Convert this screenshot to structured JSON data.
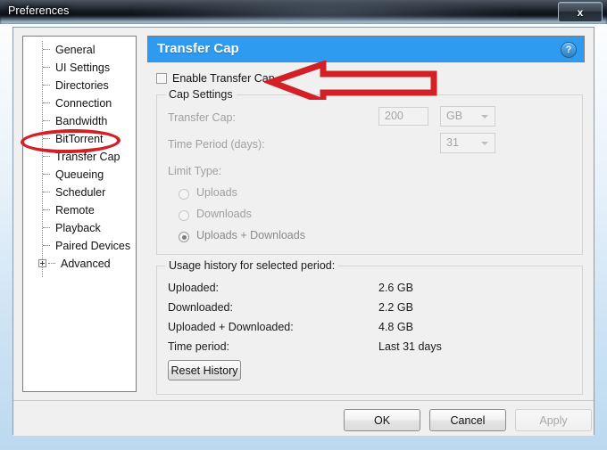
{
  "window": {
    "title": "Preferences",
    "close_label": "x",
    "close_icon": "close-icon"
  },
  "sidebar": {
    "items": [
      {
        "label": "General",
        "expandable": false,
        "selected": false
      },
      {
        "label": "UI Settings",
        "expandable": false,
        "selected": false
      },
      {
        "label": "Directories",
        "expandable": false,
        "selected": false
      },
      {
        "label": "Connection",
        "expandable": false,
        "selected": false
      },
      {
        "label": "Bandwidth",
        "expandable": false,
        "selected": false
      },
      {
        "label": "BitTorrent",
        "expandable": false,
        "selected": false
      },
      {
        "label": "Transfer Cap",
        "expandable": false,
        "selected": true
      },
      {
        "label": "Queueing",
        "expandable": false,
        "selected": false
      },
      {
        "label": "Scheduler",
        "expandable": false,
        "selected": false
      },
      {
        "label": "Remote",
        "expandable": false,
        "selected": false
      },
      {
        "label": "Playback",
        "expandable": false,
        "selected": false
      },
      {
        "label": "Paired Devices",
        "expandable": false,
        "selected": false
      },
      {
        "label": "Advanced",
        "expandable": true,
        "selected": false
      }
    ]
  },
  "page": {
    "header_title": "Transfer Cap",
    "header_bg": "#2e9bf0",
    "help_icon": "help-question-icon",
    "enable_checkbox": {
      "label": "Enable Transfer Cap",
      "checked": false
    }
  },
  "cap_settings": {
    "legend": "Cap Settings",
    "transfer_cap_label": "Transfer Cap:",
    "transfer_cap_value": "200",
    "transfer_cap_unit": "GB",
    "time_period_label": "Time Period (days):",
    "time_period_value": "31",
    "limit_type_label": "Limit Type:",
    "limit_options": [
      {
        "label": "Uploads",
        "selected": false
      },
      {
        "label": "Downloads",
        "selected": false
      },
      {
        "label": "Uploads + Downloads",
        "selected": true
      }
    ],
    "disabled": true
  },
  "usage_history": {
    "legend": "Usage history for selected period:",
    "rows": [
      {
        "label": "Uploaded:",
        "value": "2.6 GB"
      },
      {
        "label": "Downloaded:",
        "value": "2.2 GB"
      },
      {
        "label": "Uploaded + Downloaded:",
        "value": "4.8 GB"
      },
      {
        "label": "Time period:",
        "value": "Last 31 days"
      }
    ],
    "reset_button": "Reset History"
  },
  "footer": {
    "ok": "OK",
    "cancel": "Cancel",
    "apply": "Apply",
    "apply_disabled": true
  },
  "annotations": {
    "color": "#d31f26",
    "arrow": "left-pointing-arrow-annotation",
    "ellipse": "ellipse-highlight-annotation"
  }
}
